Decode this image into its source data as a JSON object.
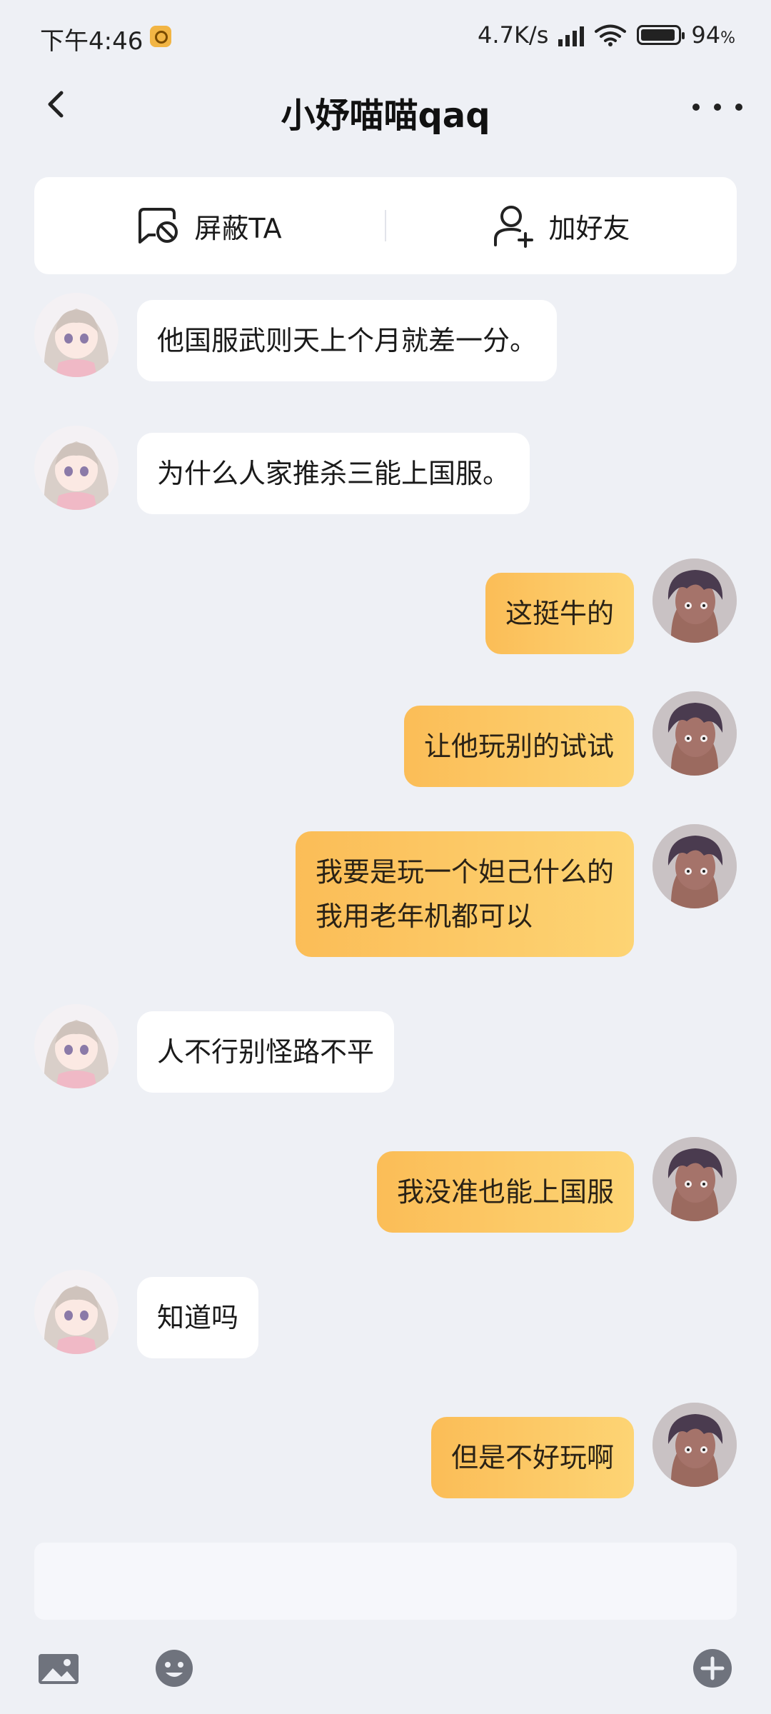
{
  "status_bar": {
    "time": "下午4:46",
    "network_speed": "4.7K/s",
    "battery_percent": "94",
    "battery_unit": "%",
    "battery_level": 0.94
  },
  "header": {
    "title": "小妤喵喵qaq",
    "back_icon": "chevron-left-icon",
    "more_icon": "more-dots-icon"
  },
  "actions": {
    "block_label": "屏蔽TA",
    "add_friend_label": "加好友"
  },
  "messages": [
    {
      "side": "left",
      "text": "他国服武则天上个月就差一分。"
    },
    {
      "side": "left",
      "text": "为什么人家推杀三能上国服。"
    },
    {
      "side": "right",
      "text": "这挺牛的"
    },
    {
      "side": "right",
      "text": "让他玩别的试试"
    },
    {
      "side": "right",
      "text": "我要是玩一个妲己什么的\n我用老年机都可以"
    },
    {
      "side": "left",
      "text": "人不行别怪路不平"
    },
    {
      "side": "right",
      "text": "我没准也能上国服"
    },
    {
      "side": "left",
      "text": "知道吗"
    },
    {
      "side": "right",
      "text": "但是不好玩啊"
    }
  ],
  "toolbar": {
    "image_icon": "image-icon",
    "emoji_icon": "emoji-icon",
    "plus_icon": "plus-circle-icon"
  },
  "colors": {
    "background": "#eef0f5",
    "outgoing_bubble_start": "#fbbd57",
    "outgoing_bubble_end": "#fdd474",
    "incoming_bubble": "#ffffff"
  }
}
